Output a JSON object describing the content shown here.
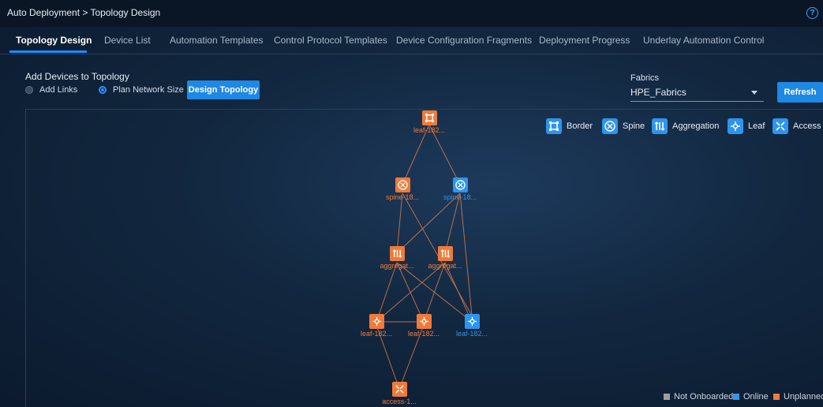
{
  "breadcrumb": "Auto Deployment > Topology Design",
  "help_icon": "?",
  "tabs": [
    {
      "label": "Topology Design"
    },
    {
      "label": "Device List"
    },
    {
      "label": "Automation Templates"
    },
    {
      "label": "Control Protocol Templates"
    },
    {
      "label": "Device Configuration Fragments"
    },
    {
      "label": "Deployment Progress"
    },
    {
      "label": "Underlay Automation Control"
    }
  ],
  "panel": {
    "title": "Add Devices to Topology",
    "radio_add_links": "Add Links",
    "radio_plan_size": "Plan Network Size",
    "selected_radio": "Plan Network Size",
    "design_button": "Design Topology"
  },
  "fabrics": {
    "label": "Fabrics",
    "value": "HPE_Fabrics",
    "refresh": "Refresh"
  },
  "legend": [
    {
      "label": "Border",
      "icon": "border-icon"
    },
    {
      "label": "Spine",
      "icon": "spine-icon"
    },
    {
      "label": "Aggregation",
      "icon": "aggregation-icon"
    },
    {
      "label": "Leaf",
      "icon": "leaf-icon"
    },
    {
      "label": "Access",
      "icon": "access-icon"
    }
  ],
  "status_legend": [
    {
      "label": "Not Onboarded",
      "color": "#9e9e9e"
    },
    {
      "label": "Online",
      "color": "#2e95ef"
    },
    {
      "label": "Unplanned",
      "color": "#f07a3a"
    }
  ],
  "colors": {
    "accent": "#1e88e5",
    "online": "#2e95ef",
    "unplanned": "#f07a3a"
  },
  "nodes": [
    {
      "id": "border",
      "type": "border",
      "label": "leaf-182...",
      "status": "unplanned"
    },
    {
      "id": "spine1",
      "type": "spine",
      "label": "spine-18...",
      "status": "unplanned"
    },
    {
      "id": "spine2",
      "type": "spine",
      "label": "spine-18...",
      "status": "online"
    },
    {
      "id": "agg1",
      "type": "aggregation",
      "label": "aggregat...",
      "status": "unplanned"
    },
    {
      "id": "agg2",
      "type": "aggregation",
      "label": "aggregat...",
      "status": "unplanned"
    },
    {
      "id": "leaf1",
      "type": "leaf",
      "label": "leaf-182...",
      "status": "unplanned"
    },
    {
      "id": "leaf2",
      "type": "leaf",
      "label": "leaf-182...",
      "status": "unplanned"
    },
    {
      "id": "leaf3",
      "type": "leaf",
      "label": "leaf-182...",
      "status": "online"
    },
    {
      "id": "access",
      "type": "access",
      "label": "access-1...",
      "status": "unplanned"
    }
  ]
}
